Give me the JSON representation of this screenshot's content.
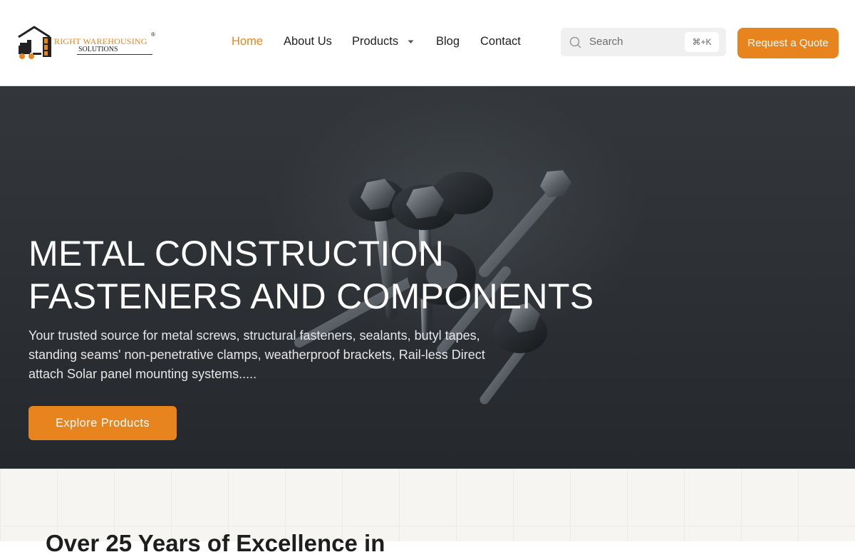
{
  "header": {
    "logo": {
      "name": "RIGHT WAREHOUSING",
      "sub": "SOLUTIONS",
      "reg": "®"
    },
    "nav": [
      {
        "label": "Home",
        "active": true
      },
      {
        "label": "About Us",
        "active": false
      },
      {
        "label": "Products",
        "active": false,
        "has_dropdown": true
      },
      {
        "label": "Blog",
        "active": false
      },
      {
        "label": "Contact",
        "active": false
      }
    ],
    "search": {
      "placeholder": "Search",
      "shortcut": "⌘+K"
    },
    "cta_label": "Request a Quote"
  },
  "hero": {
    "title_line1": "METAL CONSTRUCTION",
    "title_line2": "FASTENERS AND COMPONENTS",
    "description": "Your trusted source for metal screws, structural fasteners, sealants, butyl tapes, standing seams' non-penetrative clamps, weatherproof brackets, Rail-less Direct attach Solar panel mounting systems.....",
    "button_label": "Explore Products"
  },
  "section": {
    "title_partial": "Over 25 Years of Excellence in"
  },
  "colors": {
    "accent": "#e8841e",
    "hero_bg": "#2e3135",
    "text": "#1f1f1f"
  }
}
